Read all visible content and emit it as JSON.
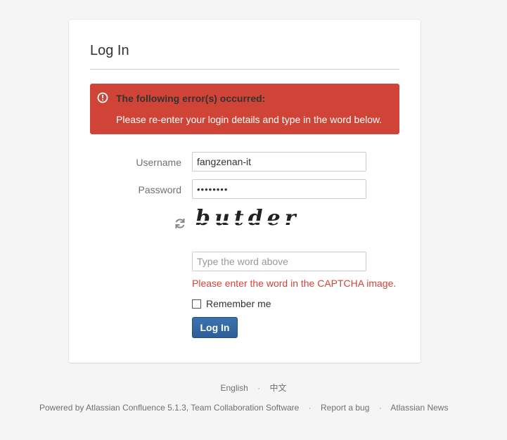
{
  "login": {
    "title": "Log In",
    "error_heading": "The following error(s) occurred:",
    "error_message": "Please re-enter your login details and type in the word below.",
    "username_label": "Username",
    "username_value": "fangzenan-it",
    "password_label": "Password",
    "password_value": "••••••••",
    "captcha_word": "butder",
    "captcha_placeholder": "Type the word above",
    "captcha_error": "Please enter the word in the CAPTCHA image.",
    "remember_label": "Remember me",
    "login_button": "Log In"
  },
  "footer": {
    "languages": [
      "English",
      "中文"
    ],
    "powered_by": "Powered by Atlassian Confluence 5.1.3, Team Collaboration Software",
    "report_bug": "Report a bug",
    "news": "Atlassian News"
  },
  "colors": {
    "error_bg": "#d04437",
    "button_bg": "#3b73af",
    "page_bg": "#f5f5f5"
  },
  "icons": {
    "error": "exclamation-circle-icon",
    "refresh": "refresh-icon"
  }
}
